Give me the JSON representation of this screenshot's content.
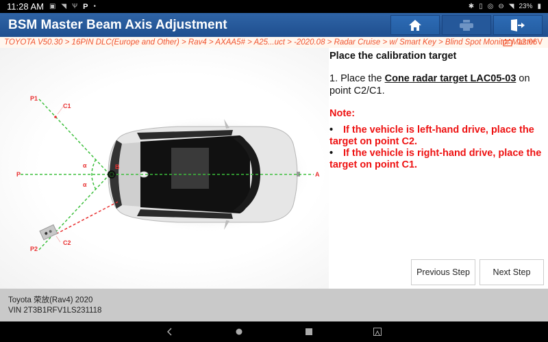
{
  "status_bar": {
    "time": "11:28 AM",
    "left_icons": [
      "image-icon",
      "wifi-off-icon",
      "usb-icon",
      "parking-icon",
      "dot-icon"
    ],
    "right_icons": [
      "bluetooth-icon",
      "vibrate-icon",
      "location-icon",
      "dnd-icon",
      "wifi-icon"
    ],
    "battery": "23%"
  },
  "header": {
    "title": "BSM Master Beam Axis Adjustment",
    "buttons": [
      {
        "name": "home",
        "icon": "home-icon",
        "enabled": true
      },
      {
        "name": "print",
        "icon": "printer-icon",
        "enabled": false
      },
      {
        "name": "exit",
        "icon": "exit-icon",
        "enabled": true
      }
    ]
  },
  "breadcrumb": {
    "path": "TOYOTA V50.30 > 16PIN DLC(Europe and Other) > Rav4 > AXAA5# > A25...uct > -2020.08 > Radar Cruise > w/ Smart Key > Blind Spot Monitor Master",
    "voltage": "12.06V"
  },
  "diagram": {
    "labels": {
      "p1": "P1",
      "c1": "C1",
      "p": "P",
      "p2": "P2",
      "c2": "C2",
      "a": "A",
      "b": "B",
      "alpha_top": "α",
      "alpha_bottom": "α"
    },
    "colors": {
      "guide_line": "#3cbf3c",
      "target_line": "#e83030",
      "label": "#e83030"
    }
  },
  "instructions": {
    "title": "Place the calibration target",
    "step_prefix": "1. Place the ",
    "step_link": "Cone radar target LAC05-03",
    "step_suffix": " on point C2/C1.",
    "note_title": "Note:",
    "notes": [
      "If the vehicle is left-hand drive, place the target on point C2.",
      "If the vehicle is right-hand drive, place the target on point C1."
    ]
  },
  "buttons": {
    "previous": "Previous Step",
    "next": "Next Step"
  },
  "footer": {
    "vehicle": "Toyota 荣放(Rav4) 2020",
    "vin": "VIN 2T3B1RFV1LS231118"
  },
  "navbar": {
    "icons": [
      "back-icon",
      "home-circle-icon",
      "recents-icon",
      "screenshot-icon"
    ]
  }
}
